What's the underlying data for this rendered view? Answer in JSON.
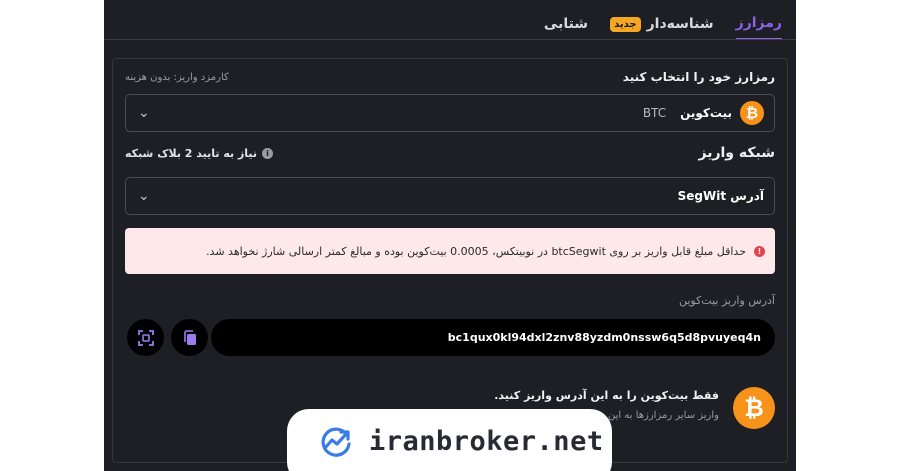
{
  "tabs": [
    {
      "label": "شتابی"
    },
    {
      "label": "شناسه‌دار",
      "badge": "جدید"
    },
    {
      "label": "رمزارز",
      "active": true
    }
  ],
  "crypto_select": {
    "label": "رمزارز خود را انتخاب کنید",
    "fee_note": "کارمزد واریز: بدون هزینه",
    "selected_name": "بیت‌کوین",
    "selected_symbol": "BTC",
    "coin_icon": "bitcoin-icon"
  },
  "network": {
    "label": "شبکه واریز",
    "confirm_note": "نیاز به تایید 2 بلاک شبکه",
    "selected": "آدرس SegWit"
  },
  "alert": {
    "text": "حداقل مبلغ قابل واریز بر روی btcSegwit در نوبیتکس، 0.0005 بیت‌کوین بوده و مبالغ کمتر ارسالی شارژ نخواهد شد."
  },
  "deposit_address": {
    "label": "آدرس واریز بیت‌کوین",
    "value": "bc1qux0kl94dxl2znv88yzdm0nssw6q5d8pvuyeq4n",
    "copy_icon": "copy-icon",
    "qr_icon": "qr-scan-icon"
  },
  "only_notice": {
    "title": "فقط بیت‌کوین را به این آدرس واریز کنید.",
    "sub": "واریز سایر رمزارزها به این"
  },
  "watermark": {
    "text": "iranbroker.net"
  },
  "colors": {
    "panel_bg": "#1e1f24",
    "accent": "#8b62e8",
    "bitcoin": "#f7931a",
    "badge": "#f5a623",
    "alert_bg": "#fde9ea",
    "alert_icon": "#e0434e"
  }
}
